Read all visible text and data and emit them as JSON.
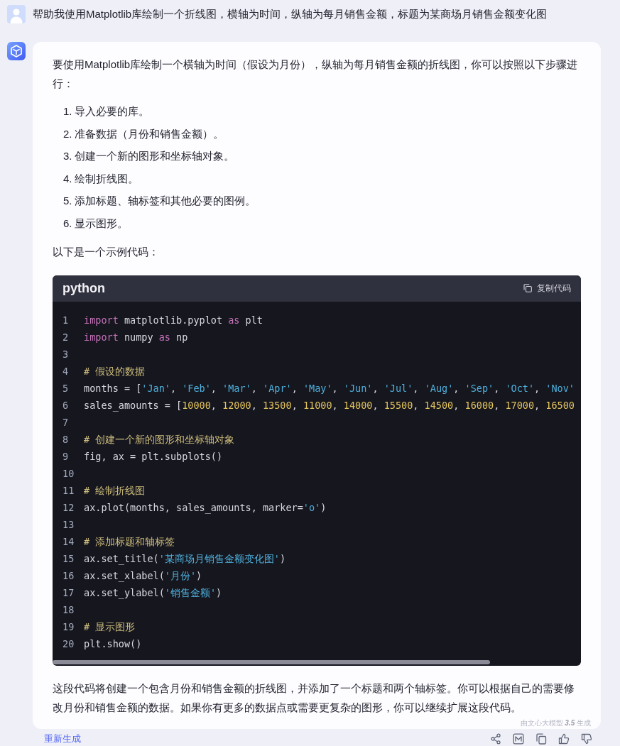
{
  "user_message": {
    "text": "帮助我使用Matplotlib库绘制一个折线图，横轴为时间，纵轴为每月销售金额，标题为某商场月销售金额变化图"
  },
  "reply": {
    "intro": "要使用Matplotlib库绘制一个横轴为时间（假设为月份），纵轴为每月销售金额的折线图，你可以按照以下步骤进行：",
    "steps": [
      {
        "number": "1.",
        "text": "导入必要的库。"
      },
      {
        "number": "2.",
        "text": "准备数据（月份和销售金额）。"
      },
      {
        "number": "3.",
        "text": "创建一个新的图形和坐标轴对象。"
      },
      {
        "number": "4.",
        "text": "绘制折线图。"
      },
      {
        "number": "5.",
        "text": "添加标题、轴标签和其他必要的图例。"
      },
      {
        "number": "6.",
        "text": "显示图形。"
      }
    ],
    "code_intro": "以下是一个示例代码：",
    "code_block": {
      "language": "python",
      "copy_button": "复制代码",
      "lines": [
        {
          "number": "1",
          "tokens": [
            {
              "kind": "keyword",
              "text": "import"
            },
            {
              "kind": "plain",
              "text": " matplotlib.pyplot "
            },
            {
              "kind": "keyword",
              "text": "as"
            },
            {
              "kind": "plain",
              "text": " plt"
            }
          ]
        },
        {
          "number": "2",
          "tokens": [
            {
              "kind": "keyword",
              "text": "import"
            },
            {
              "kind": "plain",
              "text": " numpy "
            },
            {
              "kind": "keyword",
              "text": "as"
            },
            {
              "kind": "plain",
              "text": " np"
            }
          ]
        },
        {
          "number": "3"
        },
        {
          "number": "4",
          "tokens": [
            {
              "kind": "comment",
              "text": "# 假设的数据"
            }
          ]
        },
        {
          "number": "5",
          "tokens": [
            {
              "kind": "plain",
              "text": "months = ["
            },
            {
              "kind": "string",
              "text": "'Jan'"
            },
            {
              "kind": "plain",
              "text": ", "
            },
            {
              "kind": "string",
              "text": "'Feb'"
            },
            {
              "kind": "plain",
              "text": ", "
            },
            {
              "kind": "string",
              "text": "'Mar'"
            },
            {
              "kind": "plain",
              "text": ", "
            },
            {
              "kind": "string",
              "text": "'Apr'"
            },
            {
              "kind": "plain",
              "text": ", "
            },
            {
              "kind": "string",
              "text": "'May'"
            },
            {
              "kind": "plain",
              "text": ", "
            },
            {
              "kind": "string",
              "text": "'Jun'"
            },
            {
              "kind": "plain",
              "text": ", "
            },
            {
              "kind": "string",
              "text": "'Jul'"
            },
            {
              "kind": "plain",
              "text": ", "
            },
            {
              "kind": "string",
              "text": "'Aug'"
            },
            {
              "kind": "plain",
              "text": ", "
            },
            {
              "kind": "string",
              "text": "'Sep'"
            },
            {
              "kind": "plain",
              "text": ", "
            },
            {
              "kind": "string",
              "text": "'Oct'"
            },
            {
              "kind": "plain",
              "text": ", "
            },
            {
              "kind": "string",
              "text": "'Nov'"
            }
          ]
        },
        {
          "number": "6",
          "tokens": [
            {
              "kind": "plain",
              "text": "sales_amounts = ["
            },
            {
              "kind": "number",
              "text": "10000"
            },
            {
              "kind": "plain",
              "text": ", "
            },
            {
              "kind": "number",
              "text": "12000"
            },
            {
              "kind": "plain",
              "text": ", "
            },
            {
              "kind": "number",
              "text": "13500"
            },
            {
              "kind": "plain",
              "text": ", "
            },
            {
              "kind": "number",
              "text": "11000"
            },
            {
              "kind": "plain",
              "text": ", "
            },
            {
              "kind": "number",
              "text": "14000"
            },
            {
              "kind": "plain",
              "text": ", "
            },
            {
              "kind": "number",
              "text": "15500"
            },
            {
              "kind": "plain",
              "text": ", "
            },
            {
              "kind": "number",
              "text": "14500"
            },
            {
              "kind": "plain",
              "text": ", "
            },
            {
              "kind": "number",
              "text": "16000"
            },
            {
              "kind": "plain",
              "text": ", "
            },
            {
              "kind": "number",
              "text": "17000"
            },
            {
              "kind": "plain",
              "text": ", "
            },
            {
              "kind": "number",
              "text": "16500"
            }
          ]
        },
        {
          "number": "7"
        },
        {
          "number": "8",
          "tokens": [
            {
              "kind": "comment",
              "text": "# 创建一个新的图形和坐标轴对象"
            }
          ]
        },
        {
          "number": "9",
          "tokens": [
            {
              "kind": "plain",
              "text": "fig, ax = plt.subplots()"
            }
          ]
        },
        {
          "number": "10"
        },
        {
          "number": "11",
          "tokens": [
            {
              "kind": "comment",
              "text": "# 绘制折线图"
            }
          ]
        },
        {
          "number": "12",
          "tokens": [
            {
              "kind": "plain",
              "text": "ax.plot(months, sales_amounts, marker="
            },
            {
              "kind": "string",
              "text": "'o'"
            },
            {
              "kind": "plain",
              "text": ")"
            }
          ]
        },
        {
          "number": "13"
        },
        {
          "number": "14",
          "tokens": [
            {
              "kind": "comment",
              "text": "# 添加标题和轴标签"
            }
          ]
        },
        {
          "number": "15",
          "tokens": [
            {
              "kind": "plain",
              "text": "ax.set_title("
            },
            {
              "kind": "string",
              "text": "'某商场月销售金额变化图'"
            },
            {
              "kind": "plain",
              "text": ")"
            }
          ]
        },
        {
          "number": "16",
          "tokens": [
            {
              "kind": "plain",
              "text": "ax.set_xlabel("
            },
            {
              "kind": "string",
              "text": "'月份'"
            },
            {
              "kind": "plain",
              "text": ")"
            }
          ]
        },
        {
          "number": "17",
          "tokens": [
            {
              "kind": "plain",
              "text": "ax.set_ylabel("
            },
            {
              "kind": "string",
              "text": "'销售金额'"
            },
            {
              "kind": "plain",
              "text": ")"
            }
          ]
        },
        {
          "number": "18"
        },
        {
          "number": "19",
          "tokens": [
            {
              "kind": "comment",
              "text": "# 显示图形"
            }
          ]
        },
        {
          "number": "20",
          "tokens": [
            {
              "kind": "plain",
              "text": "plt.show()"
            }
          ]
        }
      ]
    },
    "summary": "这段代码将创建一个包含月份和销售金额的折线图，并添加了一个标题和两个轴标签。你可以根据自己的需要修改月份和销售金额的数据。如果你有更多的数据点或需要更复杂的图形，你可以继续扩展这段代码。",
    "model_note": "由文心大模型 **3.5** 生成"
  },
  "actions": {
    "regenerate": "重新生成"
  }
}
